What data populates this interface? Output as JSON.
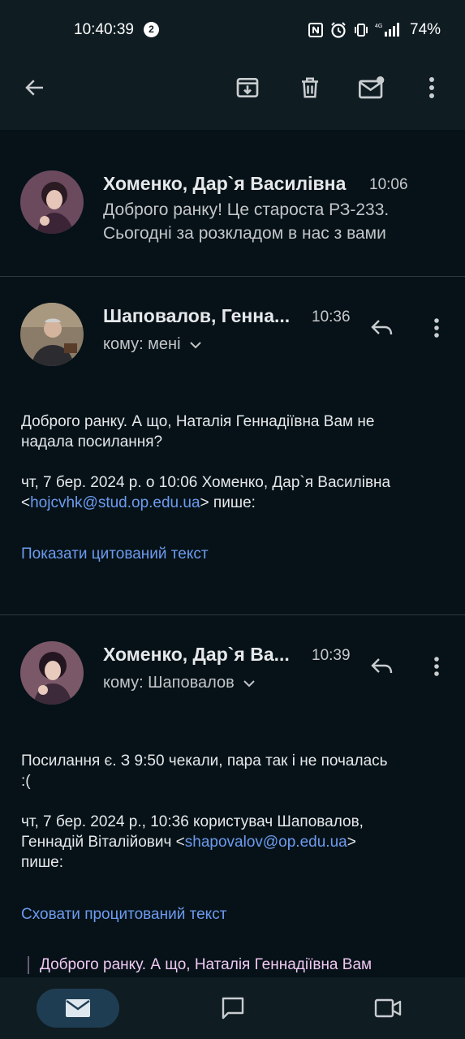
{
  "status_bar": {
    "time": "10:40:39",
    "notification_count": "2",
    "battery": "74%"
  },
  "toolbar": {
    "back": "back-arrow-icon",
    "archive": "archive-icon",
    "delete": "trash-icon",
    "mark_unread": "mail-unread-icon",
    "more": "more-vert-icon"
  },
  "messages": [
    {
      "sender": "Хоменко, Дар`я Василівна",
      "time": "10:06",
      "snippet_line1": "Доброго ранку! Це староста РЗ-233.",
      "snippet_line2": "Сьогодні за розкладом в нас з вами"
    },
    {
      "sender": "Шаповалов, Генна...",
      "time": "10:36",
      "recipient": "кому: мені",
      "body_line1": "Доброго ранку. А що, Наталія Геннадіївна Вам не",
      "body_line2": "надала посилання?",
      "quote_header_line1": "чт, 7 бер. 2024 р. о 10:06 Хоменко, Дар`я Василівна",
      "quote_header_lt": "<",
      "quote_header_email": "hojcvhk@stud.op.edu.ua",
      "quote_header_suffix": "> пише:",
      "show_quoted": "Показати цитований текст"
    },
    {
      "sender": "Хоменко, Дар`я Ва...",
      "time": "10:39",
      "recipient": "кому: Шаповалов",
      "body_line1": "Посилання є. З 9:50 чекали, пара так і не почалась",
      "body_line2": ":(",
      "quote_header_line1": "чт, 7 бер. 2024 р., 10:36 користувач Шаповалов,",
      "quote_header_prefix": "Геннадій Віталійович <",
      "quote_header_email": "shapovalov@op.edu.ua",
      "quote_header_suffix": ">",
      "quote_header_line3": "пише:",
      "hide_quoted": "Сховати процитований текст",
      "quoted_text": "Доброго ранку. А що, Наталія Геннадіївна Вам"
    }
  ],
  "bottom_nav": {
    "mail": "mail-icon",
    "chat": "chat-icon",
    "meet": "video-camera-icon"
  },
  "colors": {
    "background": "#061217",
    "bar": "#0f1c22",
    "link": "#6d9bf0",
    "active_pill": "#1f3d52",
    "quoted_text": "#f0c9f4"
  }
}
